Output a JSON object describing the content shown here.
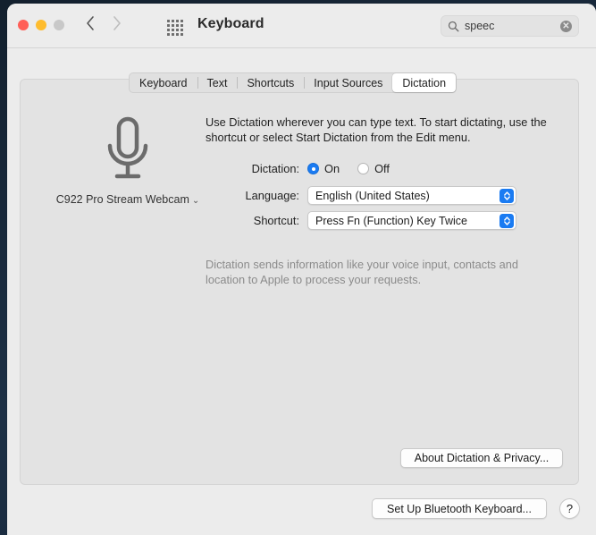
{
  "window": {
    "title": "Keyboard",
    "traffic_lights": [
      "close",
      "minimize",
      "zoom"
    ],
    "nav": {
      "back": "back-arrow",
      "forward": "forward-arrow"
    },
    "grid_icon": "show-all-grid-icon"
  },
  "search": {
    "icon": "search-icon",
    "value": "speec",
    "placeholder": "Search",
    "clear_glyph": "✕"
  },
  "tabs": [
    {
      "label": "Keyboard",
      "selected": false
    },
    {
      "label": "Text",
      "selected": false
    },
    {
      "label": "Shortcuts",
      "selected": false
    },
    {
      "label": "Input Sources",
      "selected": false
    },
    {
      "label": "Dictation",
      "selected": true
    }
  ],
  "dictation": {
    "description": "Use Dictation wherever you can type text. To start dictating, use the shortcut or select Start Dictation from the Edit menu.",
    "mic": {
      "icon": "microphone-icon",
      "source_label": "C922 Pro Stream Webcam",
      "caret": "⌄"
    },
    "rows": {
      "dictation": {
        "label": "Dictation:",
        "options": [
          {
            "label": "On",
            "selected": true
          },
          {
            "label": "Off",
            "selected": false
          }
        ]
      },
      "language": {
        "label": "Language:",
        "value": "English (United States)"
      },
      "shortcut": {
        "label": "Shortcut:",
        "value": "Press Fn (Function) Key Twice"
      }
    },
    "privacy_note": "Dictation sends information like your voice input, contacts and location to Apple to process your requests.",
    "about_button": "About Dictation & Privacy..."
  },
  "footer": {
    "bluetooth_button": "Set Up Bluetooth Keyboard...",
    "help_button": "?"
  },
  "colors": {
    "accent": "#1a7bf2",
    "window_bg": "#ececec",
    "panel_bg": "#e3e3e3",
    "text": "#1f1f1f",
    "muted_text": "#8b8b8b",
    "close": "#ff5f57",
    "minimize": "#febc2e",
    "zoom": "#c8c8c8"
  }
}
